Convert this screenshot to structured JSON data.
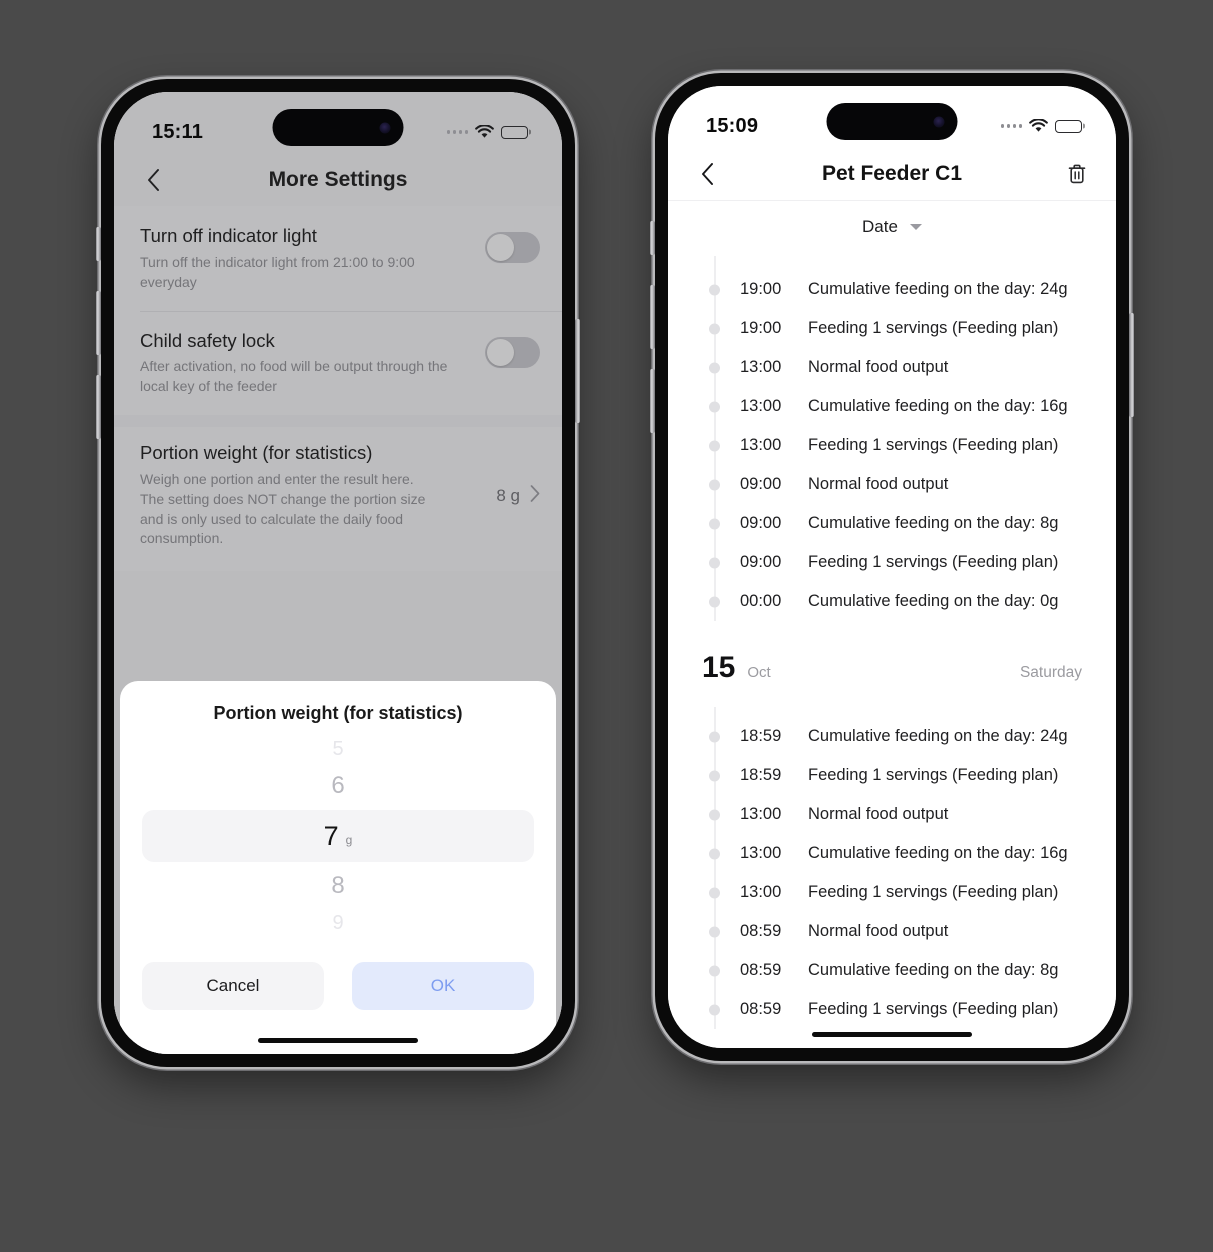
{
  "left_phone": {
    "status_bar": {
      "time": "15:11",
      "wifi_icon": "wifi-icon",
      "battery_level_pct": 32,
      "signal_icon": "signal-dots-icon"
    },
    "nav": {
      "back_icon": "chevron-left-icon",
      "title": "More Settings"
    },
    "settings": [
      {
        "name": "indicator-light",
        "title": "Turn off indicator light",
        "desc": "Turn off the indicator light from 21:00 to 9:00 everyday",
        "control": "switch",
        "switch_on": false
      },
      {
        "name": "child-safety-lock",
        "title": "Child safety lock",
        "desc": "After activation, no food will be output through the local key of the feeder",
        "control": "switch",
        "switch_on": false
      },
      {
        "name": "portion-weight",
        "title": "Portion weight (for statistics)",
        "desc": "Weigh one portion and enter the result here. The setting does NOT change the portion size and is only used to calculate the daily food consumption.",
        "control": "value",
        "value": "8 g",
        "chevron_icon": "chevron-right-icon"
      }
    ],
    "sheet": {
      "title": "Portion weight (for statistics)",
      "unit": "g",
      "options_above_faint": "5",
      "option_above": "6",
      "option_selected": "7",
      "option_below": "8",
      "options_below_faint": "9",
      "cancel_label": "Cancel",
      "ok_label": "OK"
    }
  },
  "right_phone": {
    "status_bar": {
      "time": "15:09",
      "wifi_icon": "wifi-icon",
      "battery_level_pct": 100,
      "signal_icon": "signal-dots-icon"
    },
    "nav": {
      "back_icon": "chevron-left-icon",
      "title": "Pet Feeder C1",
      "delete_icon": "trash-icon"
    },
    "filter": {
      "label": "Date",
      "caret_icon": "chevron-down-icon"
    },
    "groups": [
      {
        "date_header": null,
        "records": [
          {
            "time": "19:00",
            "text": "Cumulative feeding on the day: 24g"
          },
          {
            "time": "19:00",
            "text": "Feeding 1 servings  (Feeding plan)"
          },
          {
            "time": "13:00",
            "text": "Normal food output"
          },
          {
            "time": "13:00",
            "text": "Cumulative feeding on the day: 16g"
          },
          {
            "time": "13:00",
            "text": "Feeding 1 servings  (Feeding plan)"
          },
          {
            "time": "09:00",
            "text": "Normal food output"
          },
          {
            "time": "09:00",
            "text": "Cumulative feeding on the day: 8g"
          },
          {
            "time": "09:00",
            "text": "Feeding 1 servings  (Feeding plan)"
          },
          {
            "time": "00:00",
            "text": "Cumulative feeding on the day: 0g"
          }
        ]
      },
      {
        "date_header": {
          "day": "15",
          "month": "Oct",
          "weekday": "Saturday"
        },
        "records": [
          {
            "time": "18:59",
            "text": "Cumulative feeding on the day: 24g"
          },
          {
            "time": "18:59",
            "text": "Feeding 1 servings  (Feeding plan)"
          },
          {
            "time": "13:00",
            "text": "Normal food output"
          },
          {
            "time": "13:00",
            "text": "Cumulative feeding on the day: 16g"
          },
          {
            "time": "13:00",
            "text": "Feeding 1 servings  (Feeding plan)"
          },
          {
            "time": "08:59",
            "text": "Normal food output"
          },
          {
            "time": "08:59",
            "text": "Cumulative feeding on the day: 8g"
          },
          {
            "time": "08:59",
            "text": "Feeding 1 servings  (Feeding plan)"
          }
        ]
      }
    ]
  },
  "colors": {
    "page_background": "#4a4a4a",
    "settings_background": "#f5f5f7",
    "ok_button_bg": "#e3eafc",
    "ok_button_text": "#7e9df0",
    "switch_off": "#c9c9ce",
    "muted_text": "#8e8e93"
  }
}
